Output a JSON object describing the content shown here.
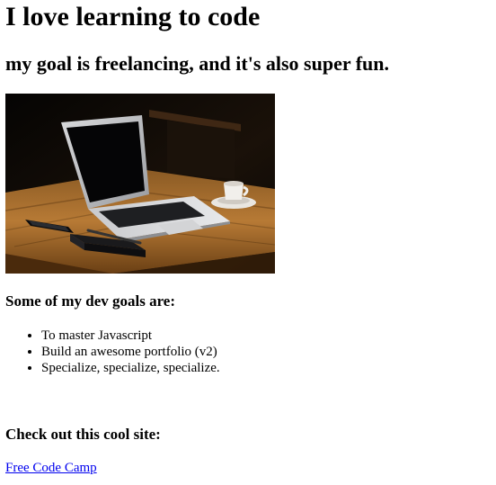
{
  "page": {
    "title": "I love learning to code",
    "subtitle": "my goal is freelancing, and it's also super fun."
  },
  "hero_image": {
    "alt": "",
    "icon": "laptop-on-wooden-desk-photo"
  },
  "goals": {
    "heading": "Some of my dev goals are:",
    "items": [
      "To master Javascript",
      "Build an awesome portfolio (v2)",
      "Specialize, specialize, specialize."
    ]
  },
  "site": {
    "heading": "Check out this cool site:",
    "link_text": "Free Code Camp"
  },
  "colors": {
    "link": "#0000ee",
    "text": "#000000",
    "background": "#ffffff"
  }
}
